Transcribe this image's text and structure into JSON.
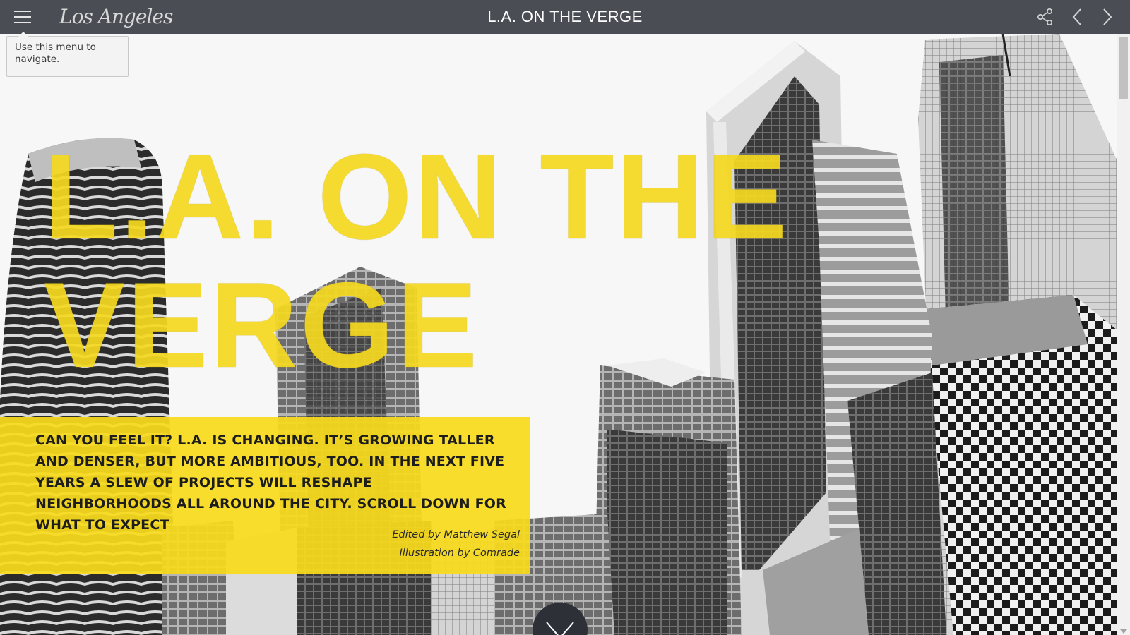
{
  "header": {
    "logo_text": "Los Angeles",
    "title": "L.A. ON THE VERGE",
    "menu_icon": "hamburger-icon",
    "share_icon": "share-icon",
    "prev_icon": "chevron-left-icon",
    "next_icon": "chevron-right-icon"
  },
  "tooltip": {
    "text": "Use this menu to navigate."
  },
  "hero": {
    "headline_line1": "L.A. ON THE",
    "headline_line2": "VERGE",
    "intro": "Can you feel it? L.A. is changing. It’s growing taller and denser, but more ambitious, too. In the next five years a slew of projects will reshape neighborhoods all around the city. Scroll down for what to expect",
    "edited_by": "Edited by Matthew Segal",
    "illustration_by": "Illustration by Comrade",
    "scroll_down_icon": "chevron-down-icon"
  },
  "colors": {
    "topbar": "#4b4d55",
    "accent_yellow": "#f5d920",
    "intro_box": "#f8da1c",
    "down_button": "#2e3038"
  }
}
